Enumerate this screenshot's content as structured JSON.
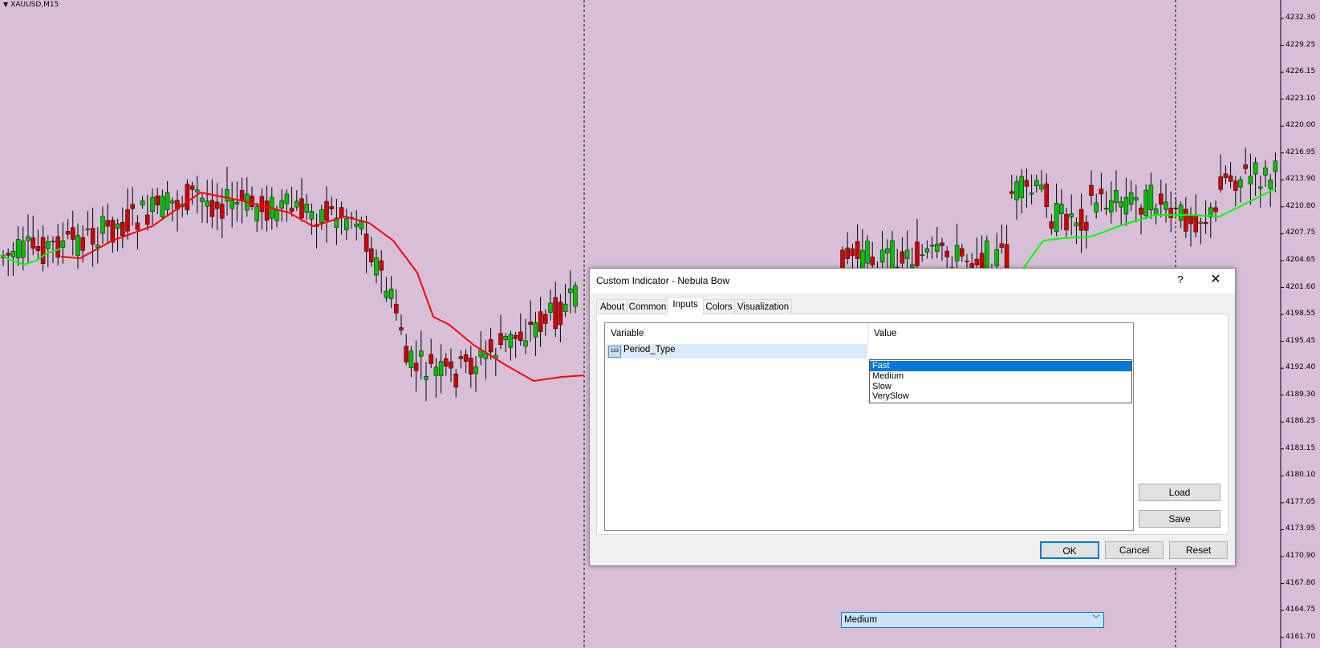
{
  "chart": {
    "symbol": "XAUUSD,M15",
    "background": "#d8bfd8",
    "price_scale": [
      "4232.30",
      "4229.25",
      "4226.15",
      "4223.10",
      "4220.00",
      "4216.95",
      "4213.90",
      "4210.80",
      "4207.75",
      "4204.65",
      "4201.60",
      "4198.55",
      "4195.45",
      "4192.40",
      "4189.30",
      "4186.25",
      "4183.15",
      "4180.10",
      "4177.05",
      "4173.95",
      "4170.90",
      "4167.80",
      "4164.75",
      "4161.70"
    ],
    "colors": {
      "bull": "#00c000",
      "bear": "#d00000",
      "ma_down": "#ff0000",
      "ma_up": "#00ff00"
    }
  },
  "dialog": {
    "title": "Custom Indicator - Nebula Bow",
    "help_label": "?",
    "close_label": "✕",
    "tabs": [
      "About",
      "Common",
      "Inputs",
      "Colors",
      "Visualization"
    ],
    "active_tab": "Inputs",
    "grid": {
      "col_variable": "Variable",
      "col_value": "Value",
      "rows": [
        {
          "icon": "123",
          "variable": "Period_Type",
          "value": "Medium"
        }
      ]
    },
    "dropdown": {
      "options": [
        "Fast",
        "Medium",
        "Slow",
        "VerySlow"
      ],
      "highlighted": "Fast"
    },
    "side_buttons": {
      "load": "Load",
      "save": "Save"
    },
    "buttons": {
      "ok": "OK",
      "cancel": "Cancel",
      "reset": "Reset"
    }
  }
}
